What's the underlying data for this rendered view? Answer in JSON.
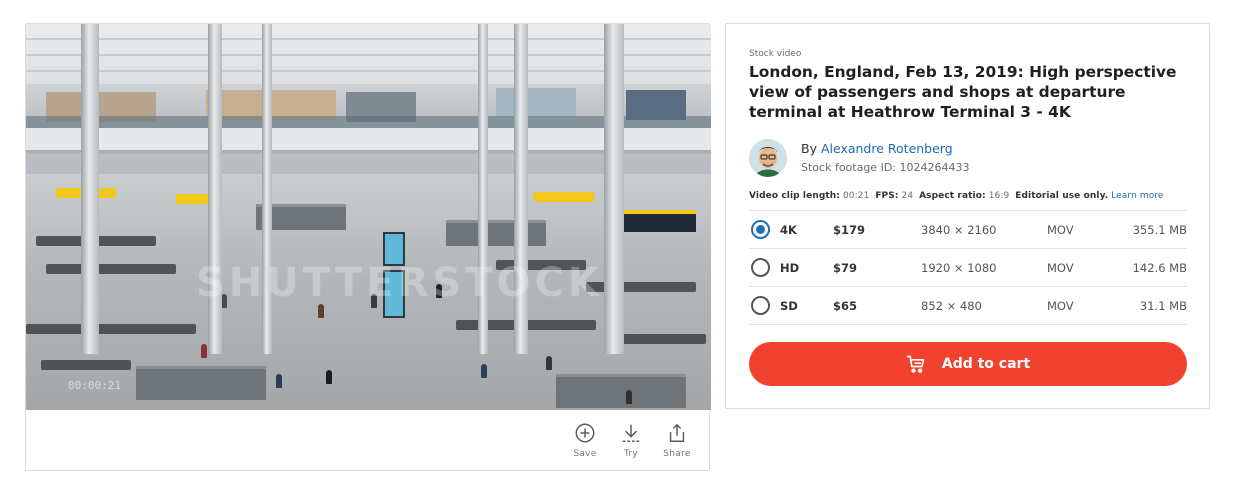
{
  "video": {
    "watermark": "SHUTTERSTOCK",
    "timecode": "00:00:21"
  },
  "actions": [
    {
      "label": "Save",
      "icon": "plus-circle-icon"
    },
    {
      "label": "Try",
      "icon": "download-icon"
    },
    {
      "label": "Share",
      "icon": "share-icon"
    }
  ],
  "details": {
    "kicker": "Stock video",
    "title": "London, England, Feb 13, 2019: High perspective view of passengers and shops at departure terminal at Heathrow Terminal 3 - 4K",
    "author_prefix": "By ",
    "author_name": "Alexandre Rotenberg",
    "footage_id": "Stock footage ID: 1024264433",
    "meta": {
      "length_label": "Video clip length:",
      "length_value": "00:21",
      "fps_label": "FPS:",
      "fps_value": "24",
      "aspect_label": "Aspect ratio:",
      "aspect_value": "16:9",
      "editorial": "Editorial use only.",
      "learn_more": "Learn more"
    },
    "formats": [
      {
        "name": "4K",
        "price": "$179",
        "resolution": "3840 × 2160",
        "type": "MOV",
        "size": "355.1 MB",
        "selected": true
      },
      {
        "name": "HD",
        "price": "$79",
        "resolution": "1920 × 1080",
        "type": "MOV",
        "size": "142.6 MB",
        "selected": false
      },
      {
        "name": "SD",
        "price": "$65",
        "resolution": "852 × 480",
        "type": "MOV",
        "size": "31.1 MB",
        "selected": false
      }
    ],
    "cart_label": "Add to cart"
  },
  "colors": {
    "accent_link": "#2069b3",
    "radio_selected": "#1e6fb8",
    "cart_button": "#f1412f"
  }
}
